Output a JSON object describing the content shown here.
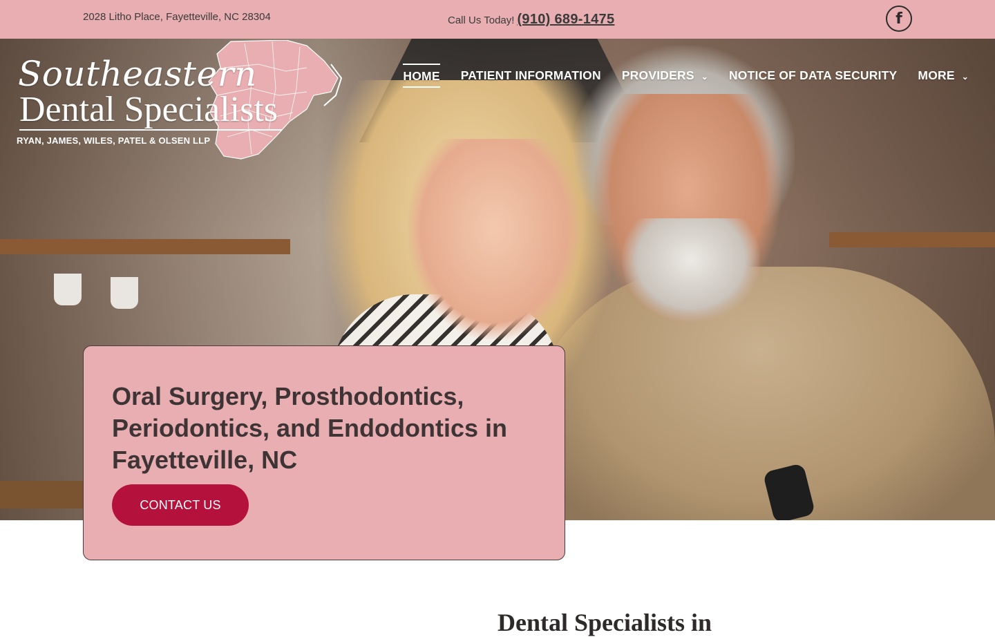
{
  "topbar": {
    "address": "2028 Litho Place, Fayetteville, NC 28304",
    "call_label": "Call Us Today!",
    "phone": "(910) 689-1475",
    "social_icon": "facebook-icon"
  },
  "logo": {
    "line1": "Southeastern",
    "line2": "Dental Specialists",
    "line3": "RYAN, JAMES, WILES, PATEL & OLSEN LLP"
  },
  "nav": {
    "items": [
      {
        "label": "HOME",
        "active": true
      },
      {
        "label": "PATIENT INFORMATION"
      },
      {
        "label": "PROVIDERS",
        "dropdown": true
      },
      {
        "label": "NOTICE OF DATA SECURITY"
      },
      {
        "label": "MORE",
        "dropdown": true
      }
    ]
  },
  "hero": {
    "heading": "Oral Surgery, Prosthodontics, Periodontics, and Endodontics in Fayetteville, NC",
    "cta_label": "CONTACT US"
  },
  "section": {
    "heading": "Dental Specialists in"
  },
  "colors": {
    "brand_pink": "#e8aeb1",
    "cta_red": "#b4123c",
    "text_dark": "#3e3436"
  }
}
